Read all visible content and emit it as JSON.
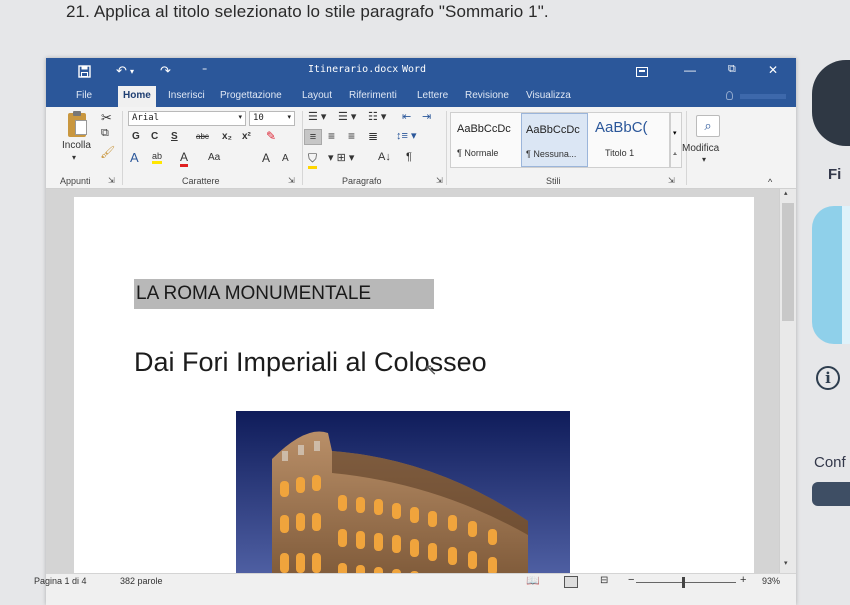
{
  "question": "21. Applica al titolo selezionato lo stile paragrafo \"Sommario 1\".",
  "window": {
    "title": "Itinerario.docx",
    "app": "Word",
    "controls": {
      "minimize": "—",
      "restore": "⧉",
      "close": "✕"
    },
    "quick_access": {
      "save_icon": "save-icon",
      "undo": "↶",
      "redo": "↷",
      "more": "⁼"
    }
  },
  "tabs": [
    "File",
    "Home",
    "Inserisci",
    "Progettazione",
    "Layout",
    "Riferimenti",
    "Lettere",
    "Revisione",
    "Visualizza"
  ],
  "active_tab": "Home",
  "ribbon": {
    "clipboard": {
      "label": "Appunti",
      "paste": "Incolla"
    },
    "font": {
      "label": "Carattere",
      "font_name": "Arial",
      "font_size": "10",
      "bold": "G",
      "italic": "C",
      "underline": "S",
      "strike": "abc",
      "sub": "x₂",
      "sup": "x²",
      "case": "Aa",
      "grow": "A",
      "shrink": "A"
    },
    "paragraph": {
      "label": "Paragrafo"
    },
    "styles": {
      "label": "Stili",
      "items": [
        {
          "preview": "AaBbCcDc",
          "name": "¶ Normale"
        },
        {
          "preview": "AaBbCcDc",
          "name": "¶ Nessuna..."
        },
        {
          "preview": "AaBbC(",
          "name": "Titolo 1"
        }
      ]
    },
    "editing": {
      "label": "Modifica"
    }
  },
  "document": {
    "heading_selected": "LA ROMA MONUMENTALE",
    "subtitle": "Dai Fori Imperiali al Colosseo"
  },
  "statusbar": {
    "page": "Pagina 1 di 4",
    "words": "382 parole",
    "zoom": "93%",
    "zoom_level": 0.93
  },
  "side": {
    "label_fi": "Fi",
    "label_conf": "Conf"
  },
  "colors": {
    "word_blue": "#2b579a",
    "selection": "#b8b8b8",
    "sky_top": "#0f1c5a",
    "sky_bottom": "#5566aa"
  }
}
